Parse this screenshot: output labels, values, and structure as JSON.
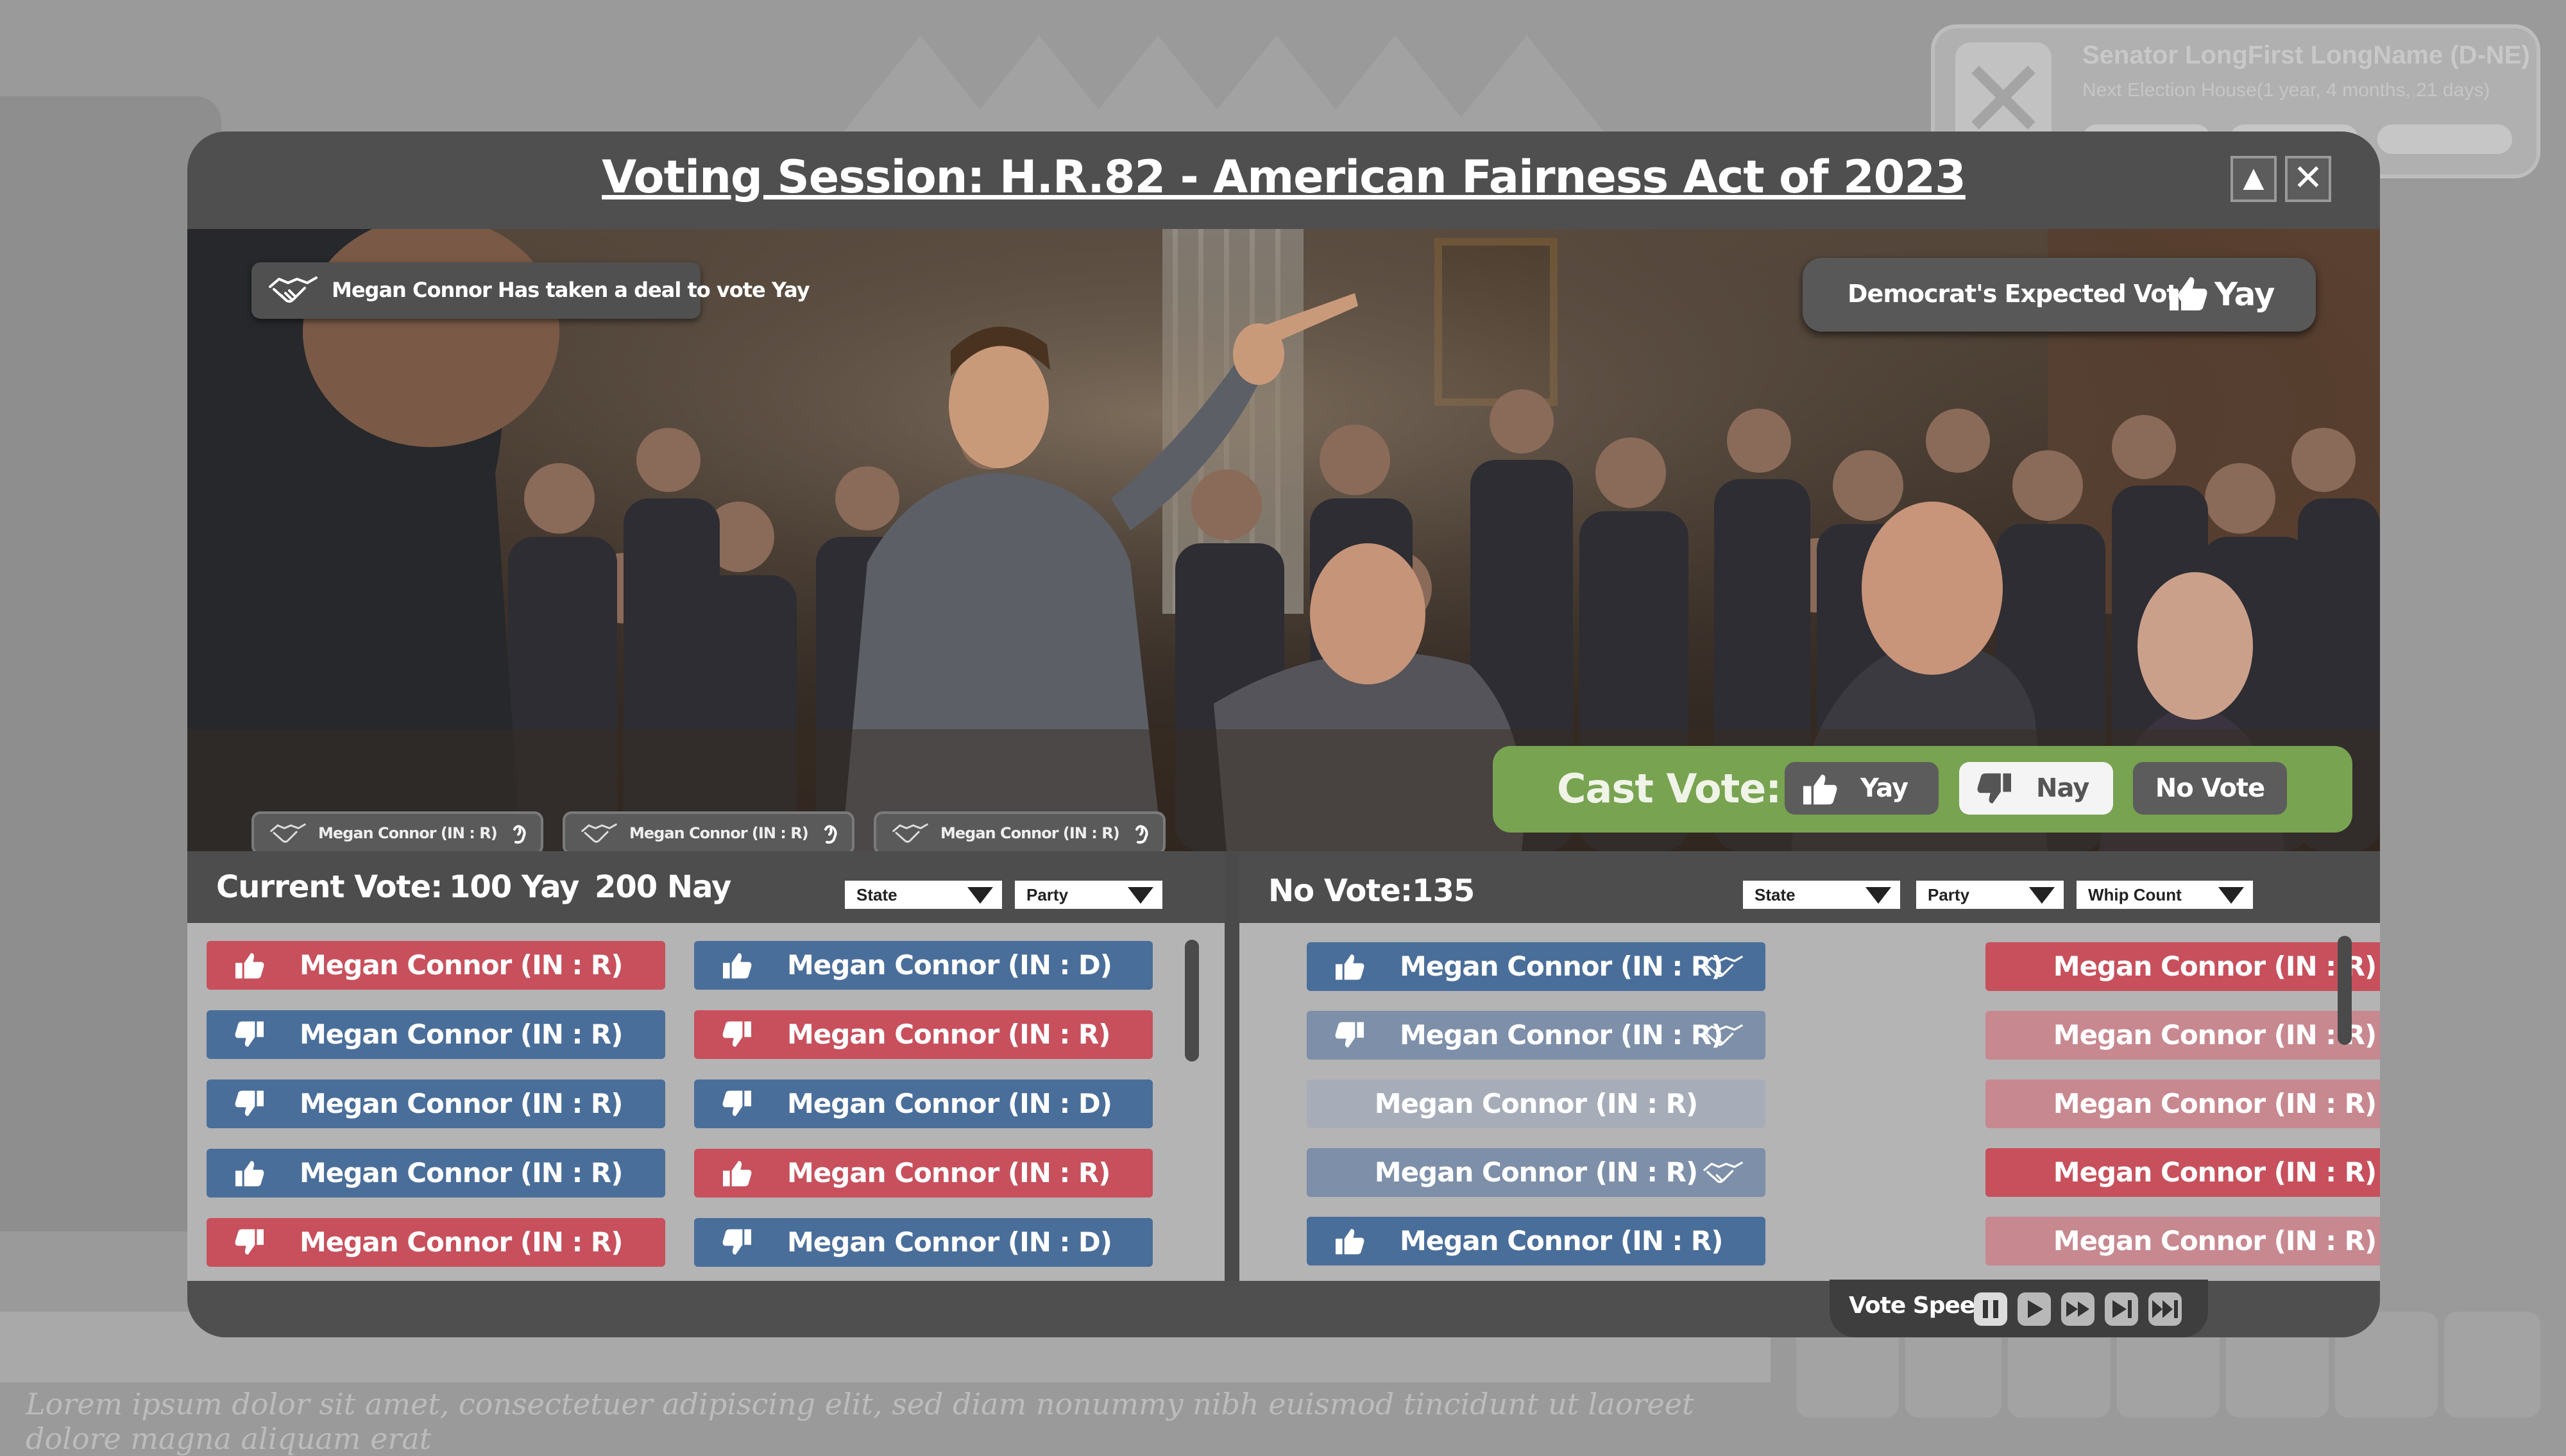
{
  "background": {
    "senator_card": {
      "name": "Senator LongFirst LongName (D-NE)",
      "next_election": "Next Election House(1 year, 4 months, 21 days)",
      "avatar_icon": "close-x-icon"
    },
    "footer_text": "Lorem ipsum dolor sit amet, consectetuer adipiscing elit, sed diam nonummy nibh euismod tincidunt ut laoreet dolore magna aliquam erat"
  },
  "modal": {
    "title": "Voting Session: H.R.82 - American Fairness Act of 2023",
    "minimize_glyph": "▲",
    "close_glyph": "✕",
    "deal_banner": "Megan Connor Has taken a deal to vote Yay",
    "expected_vote": {
      "label": "Democrat's Expected Vote:",
      "value": "Yay",
      "icon": "thumbs-up-icon"
    },
    "deal_chips": [
      "Megan Connor (IN : R)",
      "Megan Connor (IN : R)",
      "Megan Connor (IN : R)"
    ],
    "cast_vote": {
      "label": "Cast Vote:",
      "yay": "Yay",
      "nay": "Nay",
      "no_vote": "No Vote",
      "selected": "Nay",
      "accent": "#78a350"
    },
    "current_vote": {
      "label": "Current Vote:",
      "yay": "100 Yay",
      "nay": "200 Nay",
      "filters": [
        "State",
        "Party"
      ]
    },
    "no_vote": {
      "label": "No Vote:135",
      "filters": [
        "State",
        "Party",
        "Whip Count"
      ]
    },
    "left_rows": [
      {
        "name": "Megan Connor (IN : R)",
        "vote": "up",
        "color": "red"
      },
      {
        "name": "Megan Connor (IN : D)",
        "vote": "up",
        "color": "blue"
      },
      {
        "name": "Megan Connor (IN : R)",
        "vote": "down",
        "color": "blue"
      },
      {
        "name": "Megan Connor (IN : R)",
        "vote": "down",
        "color": "red"
      },
      {
        "name": "Megan Connor (IN : R)",
        "vote": "down",
        "color": "blue"
      },
      {
        "name": "Megan Connor (IN : D)",
        "vote": "down",
        "color": "blue"
      },
      {
        "name": "Megan Connor (IN : R)",
        "vote": "up",
        "color": "blue"
      },
      {
        "name": "Megan Connor (IN : R)",
        "vote": "up",
        "color": "red"
      },
      {
        "name": "Megan Connor (IN : R)",
        "vote": "down",
        "color": "red"
      },
      {
        "name": "Megan Connor (IN : D)",
        "vote": "down",
        "color": "blue"
      }
    ],
    "right_rows": [
      {
        "name": "Megan Connor (IN : R)",
        "vote": "up",
        "color": "blue",
        "deal": true
      },
      {
        "name": "Megan Connor (IN : R)",
        "vote": "none",
        "color": "red",
        "deal": false
      },
      {
        "name": "Megan Connor (IN : R)",
        "vote": "down",
        "color": "grayblue",
        "deal": true
      },
      {
        "name": "Megan Connor (IN : R)",
        "vote": "none",
        "color": "pink",
        "deal": false
      },
      {
        "name": "Megan Connor (IN : R)",
        "vote": "none",
        "color": "lightgray",
        "deal": false
      },
      {
        "name": "Megan Connor (IN : R)",
        "vote": "none",
        "color": "pink",
        "deal": false
      },
      {
        "name": "Megan Connor (IN : R)",
        "vote": "none",
        "color": "grayblue",
        "deal": true
      },
      {
        "name": "Megan Connor (IN : R)",
        "vote": "none",
        "color": "red",
        "deal": false
      },
      {
        "name": "Megan Connor (IN : R)",
        "vote": "up",
        "color": "blue",
        "deal": false
      },
      {
        "name": "Megan Connor (IN : R)",
        "vote": "none",
        "color": "pink",
        "deal": false
      }
    ],
    "vote_speed": {
      "label": "Vote Speed:",
      "controls": [
        "pause-icon",
        "play-icon",
        "fast-forward-icon",
        "skip-icon",
        "skip-end-icon"
      ]
    }
  }
}
